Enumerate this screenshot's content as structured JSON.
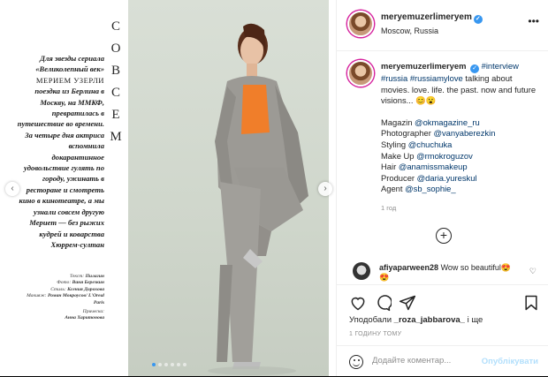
{
  "media": {
    "magazine_text": {
      "intro": "Для звезды сериала «Великолепный век»",
      "name_caps": "МЕРИЕМ УЗЕРЛИ",
      "body": "поездка из Берлина в Москву, на ММКФ, превратилась в путешествие во времени. За четыре дня актриса вспомнила докарантинное удовольствие гулять по городу, ужинать в ресторане и смотреть кино в кинотеатре, а мы узнали совсем другую Мериem — без рыжих кудрей и коварства Хюррем-султан"
    },
    "vertical_word": [
      "С",
      "О",
      "В",
      "С",
      "Е",
      "М"
    ],
    "credits": [
      {
        "label": "Текст:",
        "value": "Пилагин"
      },
      {
        "label": "Фото:",
        "value": "Ваня Березкин"
      },
      {
        "label": "Стиль:",
        "value": "Ксения Дорохова"
      },
      {
        "label": "Макияж:",
        "value": "Роман Мокроусов/ L'Oreal Paris"
      },
      {
        "label": "Прическа:",
        "value": "Анна Харитонова"
      }
    ],
    "carousel": {
      "total": 6,
      "active": 0
    }
  },
  "header": {
    "username": "meryemuzerlimeryem",
    "location": "Moscow, Russia",
    "more": "•••"
  },
  "caption": {
    "username": "meryemuzerlimeryem",
    "hashtag1": "#interview",
    "hashtag2": "#russia",
    "hashtag3": "#russiamylove",
    "line1": "talking about movies. love. life. the past. now and future visions... 😊😮",
    "magazin_label": "Magazin",
    "magazin": "@okmagazine_ru",
    "photographer_label": "Photographer",
    "photographer": "@vanyaberezkin",
    "styling_label": "Styling",
    "styling": "@chuchuka",
    "makeup_label": "Make Up",
    "makeup": "@rmokroguzov",
    "hair_label": "Hair",
    "hair": "@anamissmakeup",
    "producer_label": "Producer",
    "producer": "@daria.yureskul",
    "agent_label": "Agent",
    "agent": "@sb_sophie_",
    "time": "1 год"
  },
  "comment": {
    "username": "afiyaparween28",
    "text": "Wow so beautiful😍😍"
  },
  "actions": {
    "liked_prefix": "Уподобали",
    "liked_user": "_roza_jabbarova_",
    "liked_suffix": "і ще",
    "ago": "1 ГОДИНУ ТОМУ",
    "comment_placeholder": "Додайте коментар...",
    "publish": "Опублікувати"
  }
}
